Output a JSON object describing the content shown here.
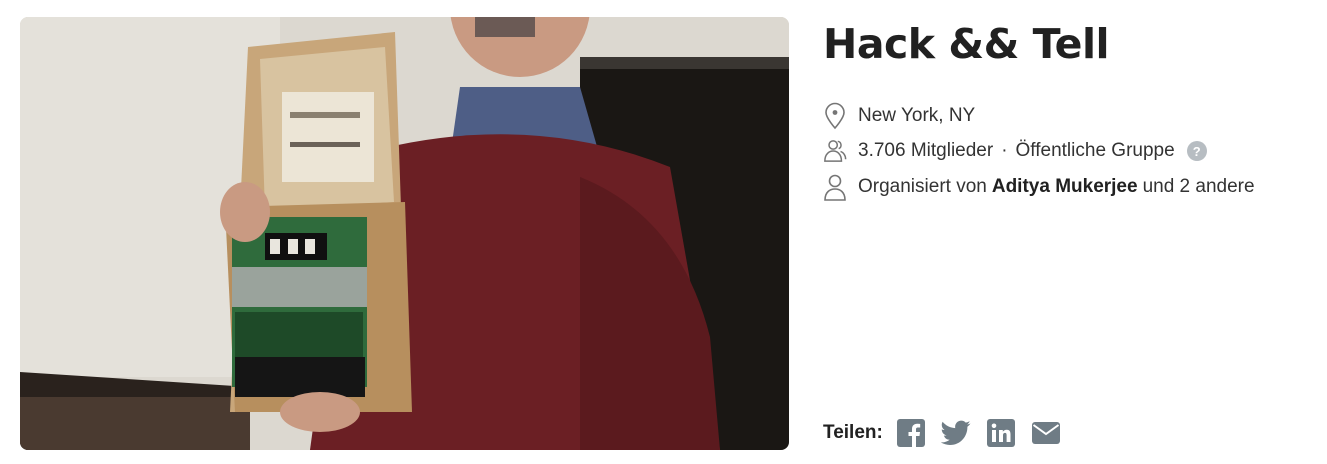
{
  "group": {
    "title": "Hack && Tell",
    "location": "New York, NY",
    "members": "3.706 Mitglieder",
    "separator": "·",
    "visibility": "Öffentliche Gruppe",
    "help_glyph": "?",
    "organizer_prefix": "Organisiert von",
    "organizer_name": "Aditya Mukerjee",
    "organizer_suffix": "und 2 andere"
  },
  "share": {
    "label": "Teilen:",
    "icons": [
      "facebook-icon",
      "twitter-icon",
      "linkedin-icon",
      "email-icon"
    ]
  },
  "colors": {
    "title": "#212121",
    "text": "#333333",
    "icon_gray": "#757575",
    "social_gray": "#6f7c85",
    "help_badge": "#b7bdc2"
  }
}
